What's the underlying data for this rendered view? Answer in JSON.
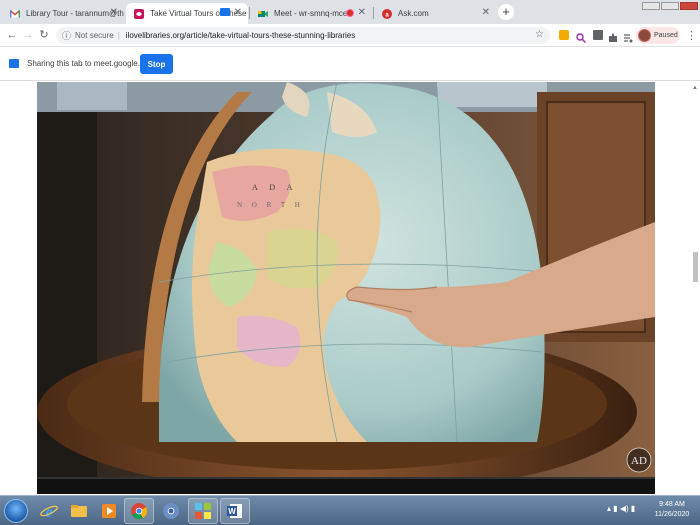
{
  "tabs": [
    {
      "label": "Library Tour - tarannum@theint",
      "favicon": "gmail-icon",
      "active": false
    },
    {
      "label": "Take Virtual Tours of These S",
      "favicon": "ilovelibraries-icon",
      "active": true,
      "sharing": true
    },
    {
      "label": "Meet - wr-smnq-mce",
      "favicon": "google-meet-icon",
      "active": false,
      "recording": true
    },
    {
      "label": "Ask.com",
      "favicon": "ask-icon",
      "active": false
    }
  ],
  "toolbar": {
    "security_label": "Not secure",
    "url": "ilovelibraries.org/article/take-virtual-tours-these-stunning-libraries",
    "profile_status": "Paused"
  },
  "sharebar": {
    "message": "Sharing this tab to meet.google.com",
    "stop_label": "Stop"
  },
  "video": {
    "watermark": "AD",
    "globe_labels": [
      "A D A",
      "N O R T H"
    ]
  },
  "taskbar": {
    "items": [
      "internet-explorer-icon",
      "file-explorer-icon",
      "media-player-icon",
      "chrome-icon",
      "chrome-canary-icon",
      "apps-icon",
      "word-icon"
    ],
    "time": "9:48 AM",
    "date": "11/26/2020"
  },
  "colors": {
    "accent": "#1a73e8",
    "tabstrip": "#dee1e6",
    "taskbar": "#4c6785"
  }
}
